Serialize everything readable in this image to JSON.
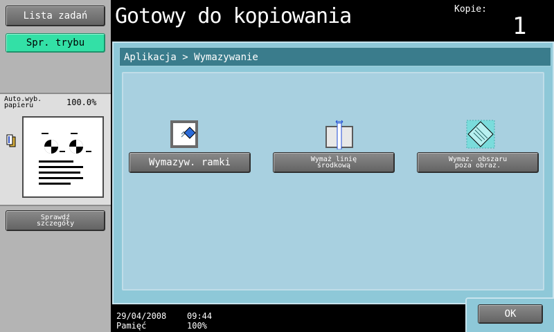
{
  "sidebar": {
    "job_list_label": "Lista zadań",
    "mode_check_label": "Spr. trybu",
    "paper_auto_label": "Auto.wyb.\npapieru",
    "zoom_value": "100.0%",
    "details_label": "Sprawdź\nszczegóły"
  },
  "header": {
    "status_title": "Gotowy do kopiowania",
    "copies_label": "Kopie:",
    "copies_value": "1"
  },
  "breadcrumb": "Aplikacja > Wymazywanie",
  "functions": [
    {
      "label": "Wymazyw. ramki",
      "icon": "frame-erase-icon"
    },
    {
      "label": "Wymaż linię\nśrodkową",
      "icon": "center-erase-icon"
    },
    {
      "label": "Wymaz. obszaru\npoza obraz.",
      "icon": "non-image-erase-icon"
    }
  ],
  "footer": {
    "date": "29/04/2008",
    "time": "09:44",
    "memory_label": "Pamięć",
    "memory_value": "100%"
  },
  "ok_label": "OK",
  "colors": {
    "panel_bg": "#8ec8d8",
    "breadcrumb_bg": "#3a7c8c",
    "mode_button": "#33e0a6",
    "sidebar_bg": "#b4b4b4"
  }
}
